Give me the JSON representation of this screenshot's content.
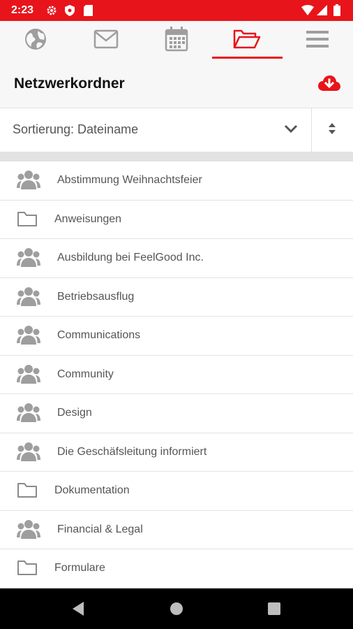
{
  "status_bar": {
    "time": "2:23",
    "left_icons": [
      "settings-icon",
      "shield-icon",
      "sd-card-icon"
    ],
    "right_icons": [
      "wifi-icon",
      "signal-icon",
      "battery-icon"
    ]
  },
  "tabs": [
    {
      "icon": "globe-icon",
      "active": false
    },
    {
      "icon": "mail-icon",
      "active": false
    },
    {
      "icon": "calendar-icon",
      "active": false
    },
    {
      "icon": "folder-open-icon",
      "active": true
    },
    {
      "icon": "menu-icon",
      "active": false
    }
  ],
  "header": {
    "title": "Netzwerkordner",
    "action_icon": "cloud-download-icon"
  },
  "sort": {
    "label": "Sortierung: Dateiname"
  },
  "items": [
    {
      "type": "group",
      "label": "Abstimmung Weihnachtsfeier"
    },
    {
      "type": "folder",
      "label": "Anweisungen"
    },
    {
      "type": "group",
      "label": "Ausbildung bei FeelGood Inc."
    },
    {
      "type": "group",
      "label": "Betriebsausflug"
    },
    {
      "type": "group",
      "label": "Communications"
    },
    {
      "type": "group",
      "label": "Community"
    },
    {
      "type": "group",
      "label": "Design"
    },
    {
      "type": "group",
      "label": "Die Geschäfsleitung informiert"
    },
    {
      "type": "folder",
      "label": "Dokumentation"
    },
    {
      "type": "group",
      "label": "Financial & Legal"
    },
    {
      "type": "folder",
      "label": "Formulare"
    }
  ],
  "colors": {
    "accent": "#e8141b",
    "icon_gray": "#9e9e9e",
    "text": "#555555"
  }
}
